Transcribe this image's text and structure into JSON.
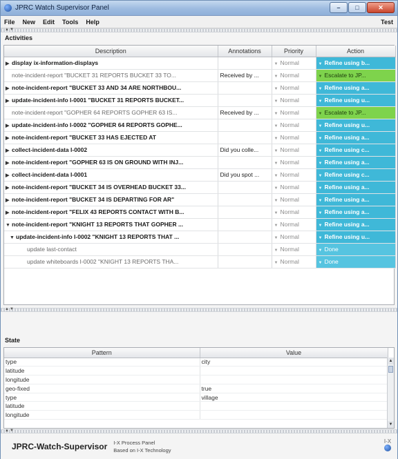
{
  "window": {
    "title": "JPRC Watch Supervisor Panel"
  },
  "menubar": {
    "items": [
      "File",
      "New",
      "Edit",
      "Tools",
      "Help"
    ],
    "right": "Test"
  },
  "activities": {
    "label": "Activities",
    "columns": [
      "Description",
      "Annotations",
      "Priority",
      "Action"
    ],
    "rows": [
      {
        "indent": 0,
        "expander": "right",
        "weight": "bold",
        "description": "display ix-information-displays",
        "annotation": "",
        "priority": "Normal",
        "action": "Refine using b...",
        "action_type": "refine"
      },
      {
        "indent": 0,
        "expander": "none",
        "weight": "light",
        "description": "note-incident-report \"BUCKET 31 REPORTS BUCKET 33 TO...",
        "annotation": "Received by ...",
        "priority": "Normal",
        "action": "Escalate to JP...",
        "action_type": "escalate"
      },
      {
        "indent": 0,
        "expander": "right",
        "weight": "bold",
        "description": "note-incident-report \"BUCKET 33 AND 34 ARE NORTHBOU...",
        "annotation": "",
        "priority": "Normal",
        "action": "Refine using a...",
        "action_type": "refine"
      },
      {
        "indent": 0,
        "expander": "right",
        "weight": "bold",
        "description": "update-incident-info I-0001 \"BUCKET 31 REPORTS BUCKET...",
        "annotation": "",
        "priority": "Normal",
        "action": "Refine using u...",
        "action_type": "refine"
      },
      {
        "indent": 0,
        "expander": "none",
        "weight": "light",
        "description": "note-incident-report \"GOPHER 64 REPORTS GOPHER 63 IS...",
        "annotation": "Received by ...",
        "priority": "Normal",
        "action": "Escalate to JP...",
        "action_type": "escalate"
      },
      {
        "indent": 0,
        "expander": "right",
        "weight": "bold",
        "description": "update-incident-info I-0002 \"GOPHER 64 REPORTS GOPHE...",
        "annotation": "",
        "priority": "Normal",
        "action": "Refine using u...",
        "action_type": "refine"
      },
      {
        "indent": 0,
        "expander": "right",
        "weight": "bold",
        "description": "note-incident-report \"BUCKET 33 HAS EJECTED AT",
        "annotation": "",
        "priority": "Normal",
        "action": "Refine using a...",
        "action_type": "refine"
      },
      {
        "indent": 0,
        "expander": "right",
        "weight": "bold",
        "description": "collect-incident-data I-0002",
        "annotation": "Did you colle...",
        "priority": "Normal",
        "action": "Refine using c...",
        "action_type": "refine"
      },
      {
        "indent": 0,
        "expander": "right",
        "weight": "bold",
        "description": "note-incident-report \"GOPHER 63 IS ON GROUND WITH INJ...",
        "annotation": "",
        "priority": "Normal",
        "action": "Refine using a...",
        "action_type": "refine"
      },
      {
        "indent": 0,
        "expander": "right",
        "weight": "bold",
        "description": "collect-incident-data I-0001",
        "annotation": "Did you spot ...",
        "priority": "Normal",
        "action": "Refine using c...",
        "action_type": "refine"
      },
      {
        "indent": 0,
        "expander": "right",
        "weight": "bold",
        "description": "note-incident-report \"BUCKET 34 IS OVERHEAD BUCKET 33...",
        "annotation": "",
        "priority": "Normal",
        "action": "Refine using a...",
        "action_type": "refine"
      },
      {
        "indent": 0,
        "expander": "right",
        "weight": "bold",
        "description": "note-incident-report \"BUCKET 34 IS DEPARTING FOR AR\"",
        "annotation": "",
        "priority": "Normal",
        "action": "Refine using a...",
        "action_type": "refine"
      },
      {
        "indent": 0,
        "expander": "right",
        "weight": "bold",
        "description": "note-incident-report \"FELIX 43 REPORTS CONTACT WITH B...",
        "annotation": "",
        "priority": "Normal",
        "action": "Refine using a...",
        "action_type": "refine"
      },
      {
        "indent": 0,
        "expander": "down",
        "weight": "bold",
        "description": "note-incident-report \"KNIGHT 13 REPORTS THAT GOPHER ...",
        "annotation": "",
        "priority": "Normal",
        "action": "Refine using a...",
        "action_type": "refine"
      },
      {
        "indent": 1,
        "expander": "down",
        "weight": "bold",
        "description": "update-incident-info I-0002 \"KNIGHT 13 REPORTS THAT ...",
        "annotation": "",
        "priority": "Normal",
        "action": "Refine using u...",
        "action_type": "refine"
      },
      {
        "indent": 2,
        "expander": "none",
        "weight": "light",
        "description": "update last-contact",
        "annotation": "",
        "priority": "Normal",
        "action": "Done",
        "action_type": "done"
      },
      {
        "indent": 2,
        "expander": "none",
        "weight": "light",
        "description": "update whiteboards I-0002 \"KNIGHT 13 REPORTS THA...",
        "annotation": "",
        "priority": "Normal",
        "action": "Done",
        "action_type": "done"
      }
    ]
  },
  "state": {
    "label": "State",
    "columns": [
      "Pattern",
      "Value"
    ],
    "rows": [
      {
        "pattern": "type",
        "value": "city"
      },
      {
        "pattern": "latitude",
        "value": ""
      },
      {
        "pattern": "longitude",
        "value": ""
      },
      {
        "pattern": "geo-fixed",
        "value": "true"
      },
      {
        "pattern": "type",
        "value": "village"
      },
      {
        "pattern": "latitude",
        "value": ""
      },
      {
        "pattern": "longitude",
        "value": ""
      }
    ]
  },
  "footer": {
    "brand": "JPRC-Watch-Supervisor",
    "line1": "I-X Process Panel",
    "line2": "Based on I-X Technology",
    "logo_text": "I-X"
  }
}
